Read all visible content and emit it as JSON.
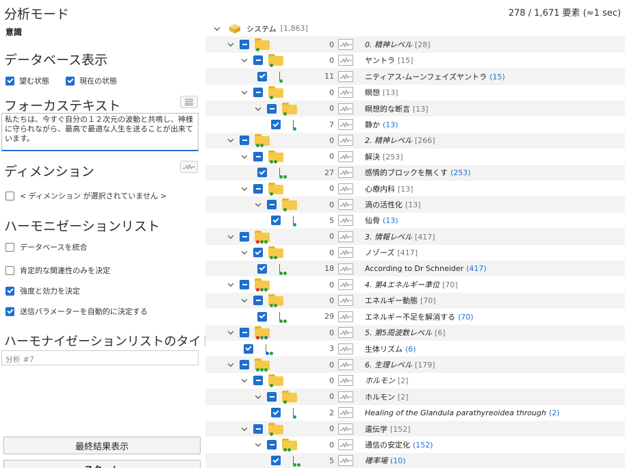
{
  "left": {
    "analysis_mode_title": "分析モード",
    "analysis_mode_value": "意識",
    "db_display_title": "データベース表示",
    "db_options": [
      {
        "label": "望む状態",
        "checked": true
      },
      {
        "label": "現在の状態",
        "checked": true
      }
    ],
    "focus_title": "フォーカステキスト",
    "focus_text": "私たちは、今すぐ自分の１２次元の波動と共鳴し、神様に守られながら、最高で最適な人生を送ることが出来ています。",
    "dimension_title": "ディメンション",
    "dimension_option": {
      "label": "< ディメンション が選択されていません >",
      "checked": false
    },
    "harmonization_title": "ハーモニゼーションリスト",
    "harmonization_options": [
      {
        "label": "データベースを統合",
        "checked": false
      },
      {
        "label": "肯定的な関連性のみを決定",
        "checked": false
      },
      {
        "label": "強度と効力を決定",
        "checked": true
      },
      {
        "label": "送信パラメーターを自動的に決定する",
        "checked": true
      }
    ],
    "list_title_heading": "ハーモナイゼーションリストのタイトル",
    "list_title_placeholder": "分析 #7",
    "final_result_button": "最終結果表示",
    "start_button": "スタート"
  },
  "status_text": "278 / 1,671 要素 (≈1 sec)",
  "tree_root": {
    "label": "システム",
    "count": "[1,863]"
  },
  "tree": [
    {
      "kind": "folder",
      "level": 1,
      "count": "0",
      "label": "0. 精神レベル",
      "num": "[28]",
      "italic": true,
      "dots": [
        "#2a9d3a"
      ]
    },
    {
      "kind": "folder",
      "level": 2,
      "count": "0",
      "label": "ヤントラ",
      "num": "[15]",
      "italic": false,
      "dots": [
        "#2a9d3a"
      ]
    },
    {
      "kind": "leaf",
      "level": 3,
      "count": "11",
      "label": "ニティアス-ムーンフェイズヤントラ",
      "num": "(15)",
      "italic": false,
      "dots": [
        "#2a9d3a"
      ]
    },
    {
      "kind": "folder",
      "level": 2,
      "count": "0",
      "label": "瞑想",
      "num": "[13]",
      "italic": false,
      "dots": [
        "#2a9d3a"
      ]
    },
    {
      "kind": "folder",
      "level": 3,
      "count": "0",
      "label": "瞑想的な断言",
      "num": "[13]",
      "italic": false,
      "dots": [
        "#2a9d3a"
      ]
    },
    {
      "kind": "leaf",
      "level": 4,
      "count": "7",
      "label": "静か",
      "num": "(13)",
      "italic": false,
      "dots": [
        "#2a9d3a"
      ]
    },
    {
      "kind": "folder",
      "level": 1,
      "count": "0",
      "label": "2. 精神レベル",
      "num": "[266]",
      "italic": true,
      "dots": [
        "#2a9d3a",
        "#2a9d3a"
      ]
    },
    {
      "kind": "folder",
      "level": 2,
      "count": "0",
      "label": "解決",
      "num": "[253]",
      "italic": false,
      "dots": [
        "#2a9d3a",
        "#2a9d3a"
      ]
    },
    {
      "kind": "leaf",
      "level": 3,
      "count": "27",
      "label": "感情的ブロックを無くす",
      "num": "(253)",
      "italic": false,
      "dots": [
        "#2a9d3a",
        "#2a9d3a"
      ]
    },
    {
      "kind": "folder",
      "level": 2,
      "count": "0",
      "label": "心療内科",
      "num": "[13]",
      "italic": false,
      "dots": [
        "#2a9d3a"
      ]
    },
    {
      "kind": "folder",
      "level": 3,
      "count": "0",
      "label": "渦の活性化",
      "num": "[13]",
      "italic": false,
      "dots": [
        "#2a9d3a"
      ]
    },
    {
      "kind": "leaf",
      "level": 4,
      "count": "5",
      "label": "仙骨",
      "num": "(13)",
      "italic": false,
      "dots": [
        "#2a9d3a"
      ]
    },
    {
      "kind": "folder",
      "level": 1,
      "count": "0",
      "label": "3. 情報レベル",
      "num": "[417]",
      "italic": true,
      "dots": [
        "#d62828",
        "#2a9d3a",
        "#2a9d3a"
      ]
    },
    {
      "kind": "folder",
      "level": 2,
      "count": "0",
      "label": "ノゾーズ",
      "num": "[417]",
      "italic": false,
      "dots": [
        "#2a9d3a",
        "#2a9d3a"
      ],
      "full": true
    },
    {
      "kind": "leaf",
      "level": 3,
      "count": "18",
      "label": "According to Dr Schneider",
      "num": "(417)",
      "italic": false,
      "dots": [
        "#2a9d3a",
        "#2a9d3a"
      ]
    },
    {
      "kind": "folder",
      "level": 1,
      "count": "0",
      "label": "4. 第4エネルギー準位",
      "num": "[70]",
      "italic": true,
      "dots": [
        "#d62828",
        "#2a9d3a",
        "#2a9d3a"
      ]
    },
    {
      "kind": "folder",
      "level": 2,
      "count": "0",
      "label": "エネルギー動態",
      "num": "[70]",
      "italic": false,
      "dots": [
        "#2a9d3a",
        "#2a9d3a"
      ]
    },
    {
      "kind": "leaf",
      "level": 3,
      "count": "29",
      "label": "エネルギー不足を解消する",
      "num": "(70)",
      "italic": false,
      "dots": [
        "#2a9d3a",
        "#2a9d3a"
      ]
    },
    {
      "kind": "folder",
      "level": 1,
      "count": "0",
      "label": "5. 第5周波数レベル",
      "num": "[6]",
      "italic": true,
      "dots": [
        "#d62828",
        "#2a9d3a",
        "#1e6fd0"
      ]
    },
    {
      "kind": "leaf",
      "level": 2,
      "count": "3",
      "label": "生体リズム",
      "num": "(6)",
      "italic": false,
      "dots": [
        "#1e6fd0",
        "#2a9d3a"
      ]
    },
    {
      "kind": "folder",
      "level": 1,
      "count": "0",
      "label": "6. 生理レベル",
      "num": "[179]",
      "italic": true,
      "dots": [
        "#2a9d3a",
        "#2a9d3a",
        "#2a9d3a"
      ]
    },
    {
      "kind": "folder",
      "level": 2,
      "count": "0",
      "label": "ホルモン",
      "num": "[2]",
      "italic": true,
      "dots": [
        "#2a9d3a"
      ]
    },
    {
      "kind": "folder",
      "level": 3,
      "count": "0",
      "label": "ホルモン",
      "num": "[2]",
      "italic": false,
      "dots": [
        "#2a9d3a"
      ]
    },
    {
      "kind": "leaf",
      "level": 4,
      "count": "2",
      "label": "Healing of the Glandula parathyreoidea through",
      "num": "(2)",
      "italic": true,
      "dots": [
        "#2a9d3a"
      ]
    },
    {
      "kind": "folder",
      "level": 2,
      "count": "0",
      "label": "遺伝学",
      "num": "[152]",
      "italic": false,
      "dots": [
        "#2a9d3a"
      ]
    },
    {
      "kind": "folder",
      "level": 3,
      "count": "0",
      "label": "通信の安定化",
      "num": "(152)",
      "italic": false,
      "dots": [
        "#2a9d3a",
        "#2a9d3a"
      ],
      "blue": true
    },
    {
      "kind": "leaf",
      "level": 4,
      "count": "5",
      "label": "確率場",
      "num": "(10)",
      "italic": true,
      "dots": [
        "#2a9d3a",
        "#2a9d3a"
      ]
    }
  ],
  "colors": {
    "accent": "#1e6fd0",
    "folder": "#f7c948",
    "alt_row": "#f3f3f3"
  }
}
